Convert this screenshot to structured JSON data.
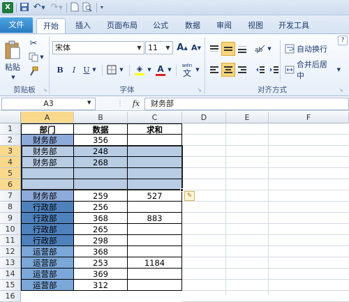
{
  "quick_access": {
    "save_icon": "save-icon",
    "undo_icon": "undo-icon",
    "redo_icon": "redo-icon",
    "new_icon": "new-document-icon",
    "preview_icon": "print-preview-icon"
  },
  "tabs": [
    "文件",
    "开始",
    "插入",
    "页面布局",
    "公式",
    "数据",
    "审阅",
    "视图",
    "开发工具"
  ],
  "ribbon": {
    "clipboard": {
      "paste_label": "粘贴",
      "group_label": "剪贴板"
    },
    "font": {
      "font_name": "宋体",
      "font_size": "11",
      "grow_label": "A",
      "shrink_label": "A",
      "bold": "B",
      "italic": "I",
      "underline": "U",
      "font_color_label": "A",
      "phonetic_label": "wén",
      "group_label": "字体"
    },
    "alignment": {
      "wrap_label": "自动换行",
      "merge_label": "合并后居中",
      "group_label": "对齐方式"
    }
  },
  "formula_bar": {
    "name_box": "A3",
    "fx": "fx",
    "value": "财务部"
  },
  "columns": [
    "A",
    "B",
    "C",
    "D",
    "E",
    "F"
  ],
  "rows": [
    {
      "n": "1",
      "a": "部门",
      "b": "数据",
      "c": "求和"
    },
    {
      "n": "2",
      "a": "财务部",
      "b": "356",
      "c": ""
    },
    {
      "n": "3",
      "a": "财务部",
      "b": "248",
      "c": ""
    },
    {
      "n": "4",
      "a": "财务部",
      "b": "268",
      "c": ""
    },
    {
      "n": "5",
      "a": "",
      "b": "",
      "c": ""
    },
    {
      "n": "6",
      "a": "",
      "b": "",
      "c": ""
    },
    {
      "n": "7",
      "a": "财务部",
      "b": "259",
      "c": "527"
    },
    {
      "n": "8",
      "a": "行政部",
      "b": "256",
      "c": ""
    },
    {
      "n": "9",
      "a": "行政部",
      "b": "368",
      "c": "883"
    },
    {
      "n": "10",
      "a": "行政部",
      "b": "265",
      "c": ""
    },
    {
      "n": "11",
      "a": "行政部",
      "b": "298",
      "c": ""
    },
    {
      "n": "12",
      "a": "运营部",
      "b": "368",
      "c": ""
    },
    {
      "n": "13",
      "a": "运营部",
      "b": "253",
      "c": "1184"
    },
    {
      "n": "14",
      "a": "运营部",
      "b": "369",
      "c": ""
    },
    {
      "n": "15",
      "a": "运营部",
      "b": "312",
      "c": ""
    },
    {
      "n": "16",
      "a": "",
      "b": "",
      "c": ""
    }
  ],
  "colors": {
    "finance_fill": "#8eaadb",
    "admin_fill": "#4f81bd",
    "ops_fill": "#7ba7d9",
    "selection_fill": "#b8cce4",
    "header_selected": "#f9d98c"
  }
}
